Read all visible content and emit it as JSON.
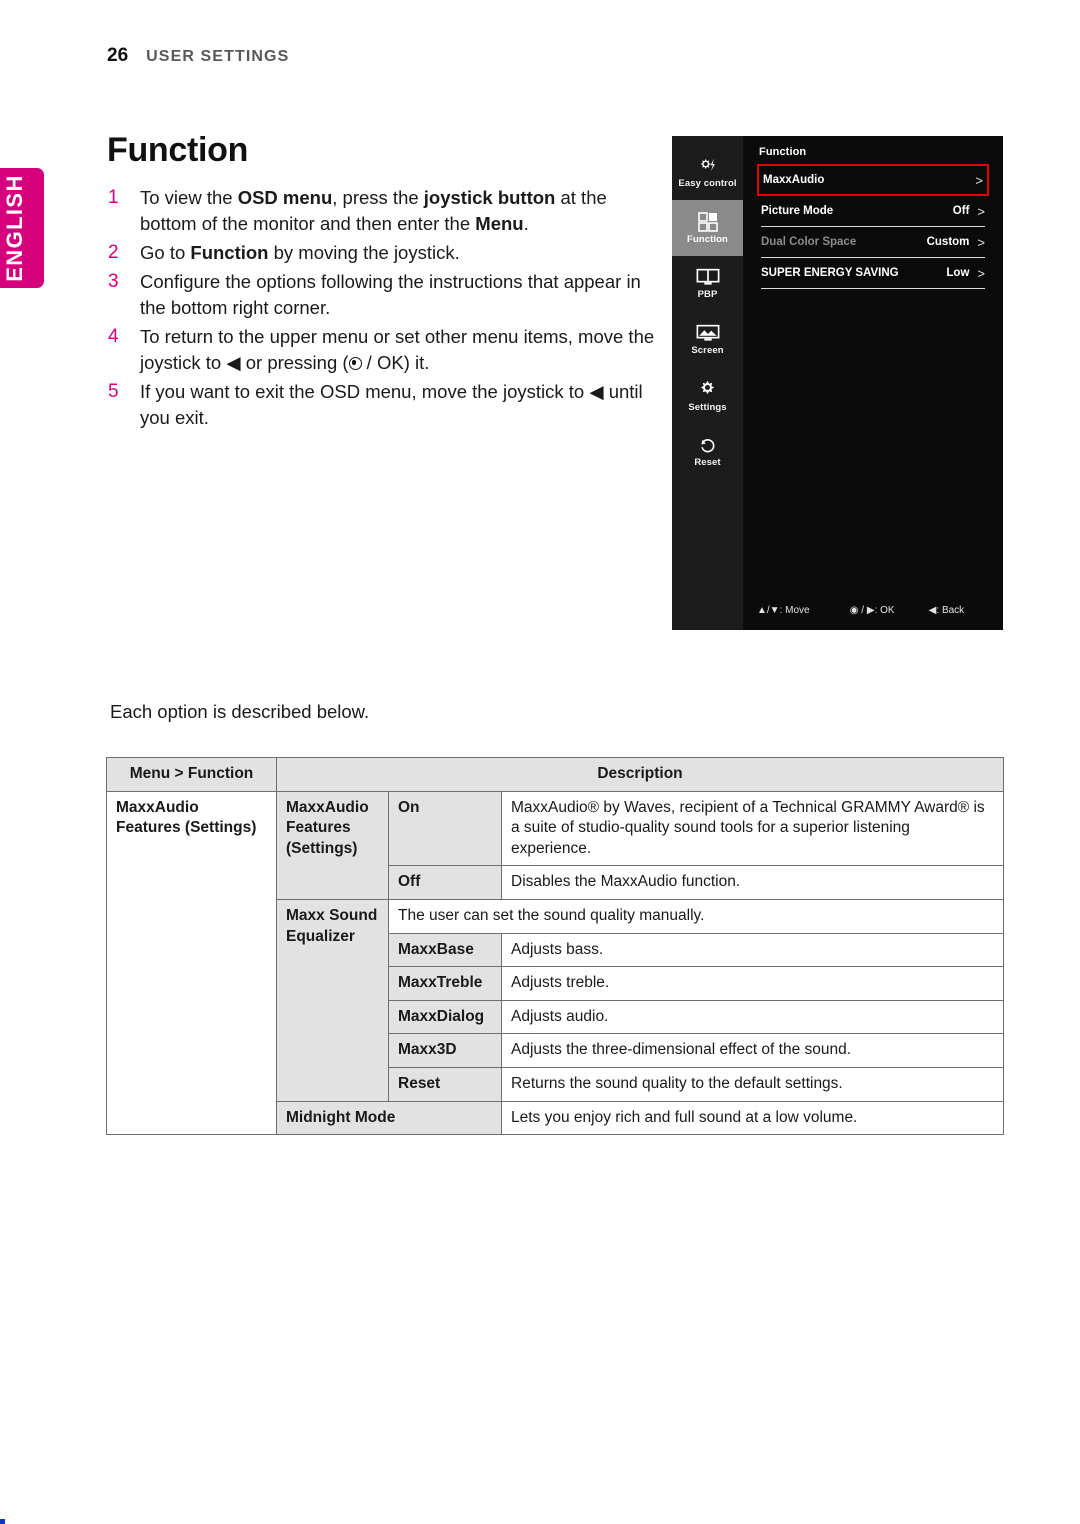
{
  "language_tab": {
    "label": "ENGLISH",
    "color": "#d6007f"
  },
  "header": {
    "page_number": "26",
    "section": "USER SETTINGS"
  },
  "title": "Function",
  "steps": [
    {
      "num": "1",
      "html": "To view the <b>OSD menu</b>, press the <b>joystick button</b> at the bottom of the monitor and then enter the <b>Menu</b>."
    },
    {
      "num": "2",
      "html": "Go to <b>Function</b> by moving the joystick."
    },
    {
      "num": "3",
      "html": "Configure the options following the instructions that appear in the bottom right corner."
    },
    {
      "num": "4",
      "html": "To return to the upper menu or set other menu items, move the joystick to ◀ or pressing (<span class=\"dot-ok\"></span> / OK) it."
    },
    {
      "num": "5",
      "html": "If you want to exit the OSD menu, move the joystick to ◀ until you exit."
    }
  ],
  "osd": {
    "rail": [
      {
        "label": "Easy control",
        "icon": "sun-lightning-icon",
        "active": false
      },
      {
        "label": "Function",
        "icon": "grid-panels-icon",
        "active": true
      },
      {
        "label": "PBP",
        "icon": "split-screen-icon",
        "active": false
      },
      {
        "label": "Screen",
        "icon": "picture-icon",
        "active": false
      },
      {
        "label": "Settings",
        "icon": "gear-icon",
        "active": false
      },
      {
        "label": "Reset",
        "icon": "undo-arrow-icon",
        "active": false
      }
    ],
    "panel_title": "Function",
    "rows": [
      {
        "label": "MaxxAudio",
        "value": "",
        "arrow": ">",
        "highlighted": true,
        "dim": false
      },
      {
        "label": "Picture Mode",
        "value": "Off",
        "arrow": ">",
        "highlighted": false,
        "dim": false
      },
      {
        "label": "Dual Color Space",
        "value": "Custom",
        "arrow": ">",
        "highlighted": false,
        "dim": true
      },
      {
        "label": "SUPER ENERGY SAVING",
        "value": "Low",
        "arrow": ">",
        "highlighted": false,
        "dim": false
      }
    ],
    "hints": [
      {
        "keys": "▲/▼",
        "action": "Move"
      },
      {
        "keys": "◉ / ▶",
        "action": "OK"
      },
      {
        "keys": "◀",
        "action": "Back"
      }
    ],
    "accent_color": "#e10000"
  },
  "lead_line": "Each option is described below.",
  "table": {
    "headers": {
      "menu": "Menu > Function",
      "description": "Description"
    },
    "group_label": "MaxxAudio Features (Settings)",
    "rows": [
      {
        "sub": "MaxxAudio Features (Settings)",
        "item": "On",
        "desc": "MaxxAudio® by Waves, recipient of a Technical GRAMMY Award® is a suite of studio-quality sound tools for a superior listening experience."
      },
      {
        "sub": "",
        "item": "Off",
        "desc": "Disables the MaxxAudio function."
      },
      {
        "sub": "Maxx Sound Equalizer",
        "item": "",
        "desc": "The user can set the sound quality manually."
      },
      {
        "sub": "",
        "item": "MaxxBase",
        "desc": "Adjusts bass."
      },
      {
        "sub": "",
        "item": "MaxxTreble",
        "desc": "Adjusts treble."
      },
      {
        "sub": "",
        "item": "MaxxDialog",
        "desc": "Adjusts audio."
      },
      {
        "sub": "",
        "item": "Maxx3D",
        "desc": "Adjusts the three-dimensional effect of the sound."
      },
      {
        "sub": "",
        "item": "Reset",
        "desc": "Returns the sound quality to the default settings."
      },
      {
        "sub": "Midnight Mode",
        "item": "",
        "desc": "Lets you enjoy rich and full sound at a low volume."
      }
    ]
  }
}
